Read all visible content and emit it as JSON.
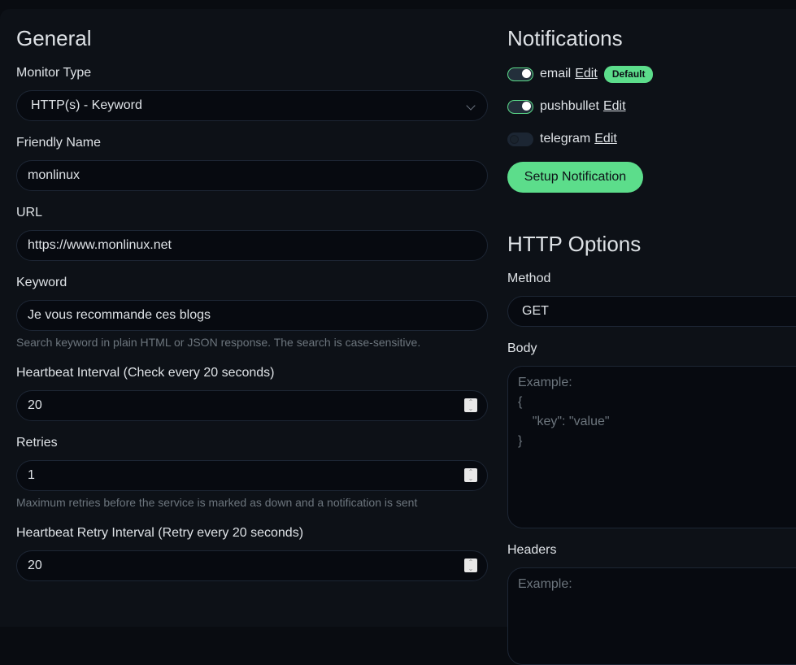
{
  "general": {
    "title": "General",
    "monitor_type": {
      "label": "Monitor Type",
      "value": "HTTP(s) - Keyword"
    },
    "friendly_name": {
      "label": "Friendly Name",
      "value": "monlinux"
    },
    "url": {
      "label": "URL",
      "value": "https://www.monlinux.net"
    },
    "keyword": {
      "label": "Keyword",
      "value": "Je vous recommande ces blogs",
      "help": "Search keyword in plain HTML or JSON response. The search is case-sensitive."
    },
    "heartbeat_interval": {
      "label": "Heartbeat Interval (Check every 20 seconds)",
      "value": "20"
    },
    "retries": {
      "label": "Retries",
      "value": "1",
      "help": "Maximum retries before the service is marked as down and a notification is sent"
    },
    "retry_interval": {
      "label": "Heartbeat Retry Interval (Retry every 20 seconds)",
      "value": "20"
    }
  },
  "notifications": {
    "title": "Notifications",
    "items": [
      {
        "name": "email",
        "enabled": true,
        "edit_label": "Edit",
        "badge": "Default"
      },
      {
        "name": "pushbullet",
        "enabled": true,
        "edit_label": "Edit"
      },
      {
        "name": "telegram",
        "enabled": false,
        "edit_label": "Edit"
      }
    ],
    "setup_button": "Setup Notification"
  },
  "http_options": {
    "title": "HTTP Options",
    "method": {
      "label": "Method",
      "value": "GET"
    },
    "body": {
      "label": "Body",
      "placeholder": "Example:\n{\n    \"key\": \"value\"\n}"
    },
    "headers": {
      "label": "Headers",
      "placeholder": "Example:"
    }
  },
  "colors": {
    "accent": "#5cdd8b",
    "background": "#0d1117",
    "input_background": "#070a10"
  }
}
